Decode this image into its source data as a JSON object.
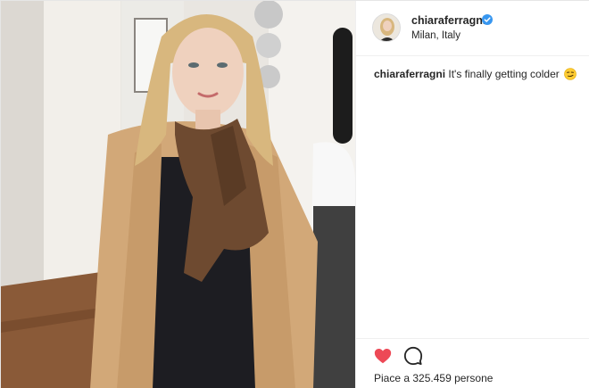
{
  "post": {
    "username": "chiaraferragni",
    "location": "Milan, Italy",
    "caption": {
      "username": "chiaraferragni",
      "text": "It's finally getting colder",
      "emoji": "smirking-face"
    },
    "likes_text": "Piace a 325.459 persone",
    "liked": true
  },
  "colors": {
    "heart": "#ed4956",
    "verified": "#3897f0",
    "coat": "#d2a878",
    "scarf": "#6e4a30",
    "hair": "#d8b77e"
  },
  "icons": {
    "verified": "verified-badge-icon",
    "like": "heart-icon",
    "comment": "speech-bubble-icon"
  }
}
